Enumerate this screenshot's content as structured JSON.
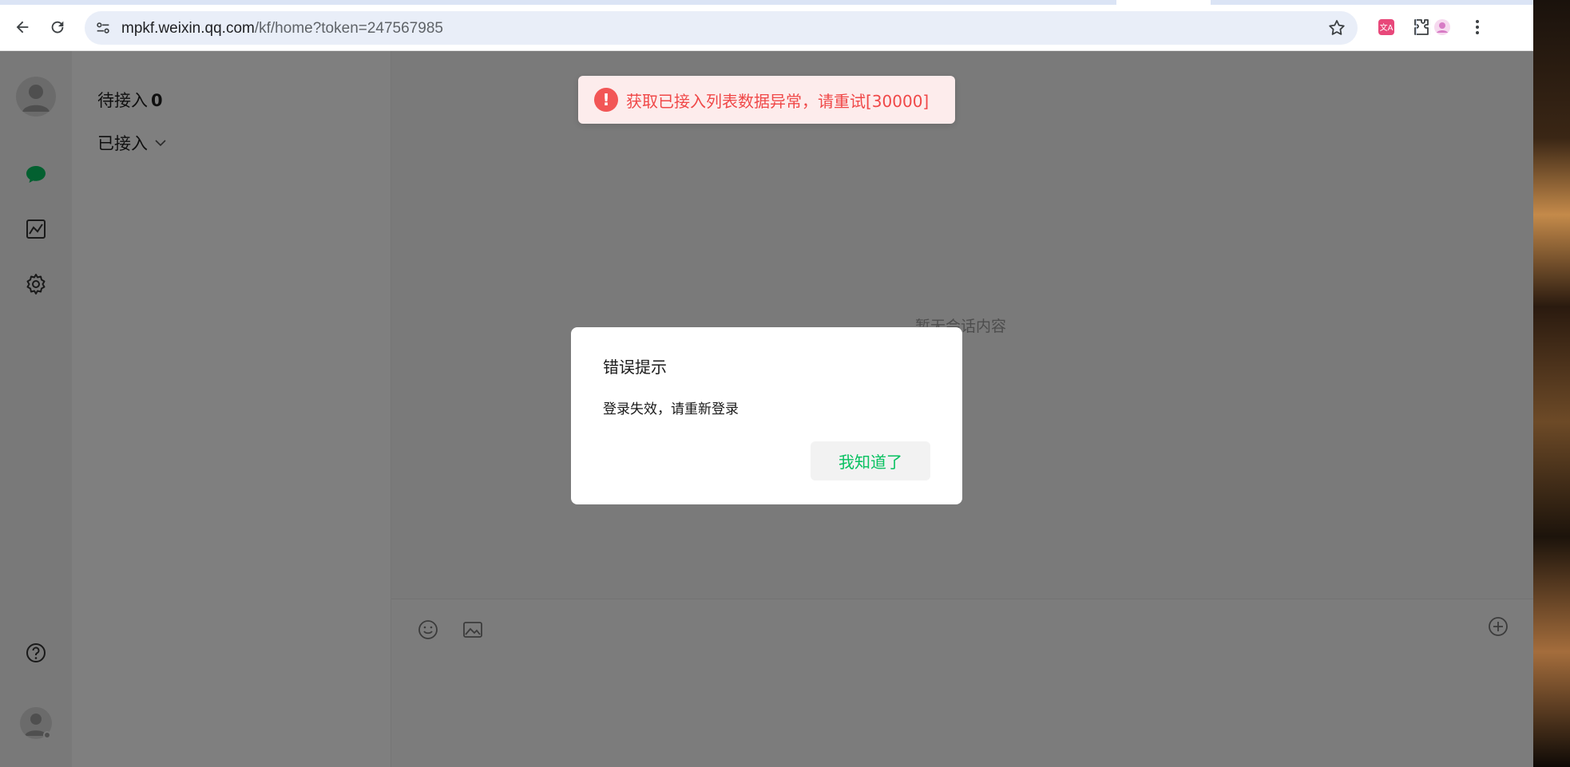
{
  "browser": {
    "url_host": "mpkf.weixin.qq.com",
    "url_path": "/kf/home?token=247567985",
    "icons": [
      "back-arrow-icon",
      "reload-icon",
      "site-settings-icon",
      "bookmark-star-icon",
      "translate-extension-icon",
      "extensions-puzzle-icon",
      "profile-icon",
      "more-menu-icon"
    ]
  },
  "sidebar": {
    "icons": [
      "user-avatar-icon",
      "chat-bubble-icon",
      "stats-chart-icon",
      "settings-gear-icon",
      "help-question-icon",
      "account-avatar-icon"
    ],
    "active_color": "#07c160"
  },
  "session_list": {
    "pending_label": "待接入",
    "pending_count": "0",
    "connected_label": "已接入"
  },
  "main": {
    "empty_hint": "暂无会话内容",
    "composer_icons": [
      "emoji-icon",
      "image-icon",
      "add-circle-icon"
    ]
  },
  "toast": {
    "message": "获取已接入列表数据异常，请重试[30000]",
    "icon_glyph": "!",
    "color": "#f04848"
  },
  "dialog": {
    "title": "错误提示",
    "body": "登录失效，请重新登录",
    "ok_label": "我知道了",
    "accent": "#07c160"
  }
}
